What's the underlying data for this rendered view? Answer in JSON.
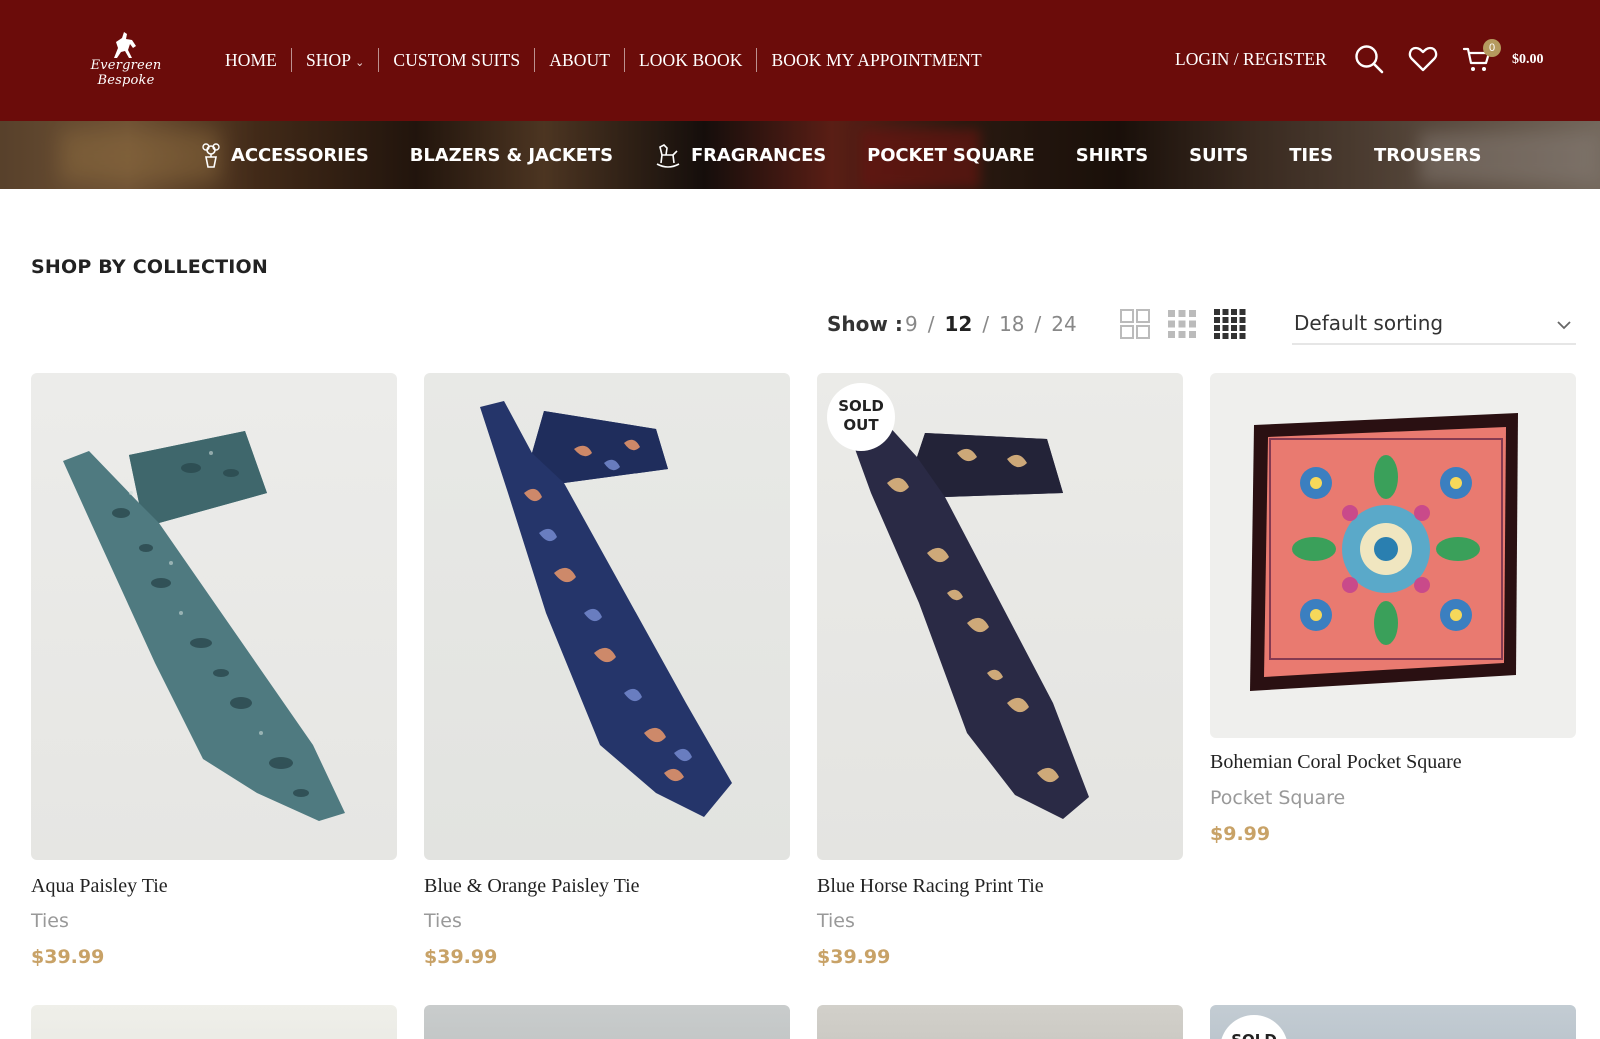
{
  "brand": {
    "logo_text": "Evergreen Bespoke"
  },
  "nav": {
    "items": [
      {
        "label": "HOME"
      },
      {
        "label": "SHOP"
      },
      {
        "label": "CUSTOM SUITS"
      },
      {
        "label": "ABOUT"
      },
      {
        "label": "LOOK BOOK"
      },
      {
        "label": "BOOK MY APPOINTMENT"
      }
    ],
    "login_label": "LOGIN / REGISTER",
    "cart_count": "0",
    "cart_total": "$0.00"
  },
  "categories": [
    {
      "label": "ACCESSORIES",
      "icon": "plant-pot-icon"
    },
    {
      "label": "BLAZERS & JACKETS",
      "icon": ""
    },
    {
      "label": "FRAGRANCES",
      "icon": "rocking-horse-icon"
    },
    {
      "label": "POCKET SQUARE",
      "icon": ""
    },
    {
      "label": "SHIRTS",
      "icon": ""
    },
    {
      "label": "SUITS",
      "icon": ""
    },
    {
      "label": "TIES",
      "icon": ""
    },
    {
      "label": "TROUSERS",
      "icon": ""
    }
  ],
  "toolbar": {
    "section_title": "SHOP BY COLLECTION",
    "show_label": "Show :",
    "show_options": [
      "9",
      "12",
      "18",
      "24"
    ],
    "show_selected": "12",
    "sort_label": "Default sorting"
  },
  "products": [
    {
      "name": "Aqua Paisley Tie",
      "category": "Ties",
      "price": "$39.99",
      "badge": ""
    },
    {
      "name": "Blue & Orange Paisley Tie",
      "category": "Ties",
      "price": "$39.99",
      "badge": ""
    },
    {
      "name": "Blue Horse Racing Print Tie",
      "category": "Ties",
      "price": "$39.99",
      "badge": "SOLD OUT"
    },
    {
      "name": "Bohemian Coral Pocket Square",
      "category": "Pocket Square",
      "price": "$9.99",
      "badge": ""
    }
  ],
  "next_row": {
    "badge_partial": "SOLD"
  },
  "colors": {
    "header_bg": "#6b0c0a",
    "price": "#c8a267",
    "cart_badge": "#b59a5e"
  }
}
